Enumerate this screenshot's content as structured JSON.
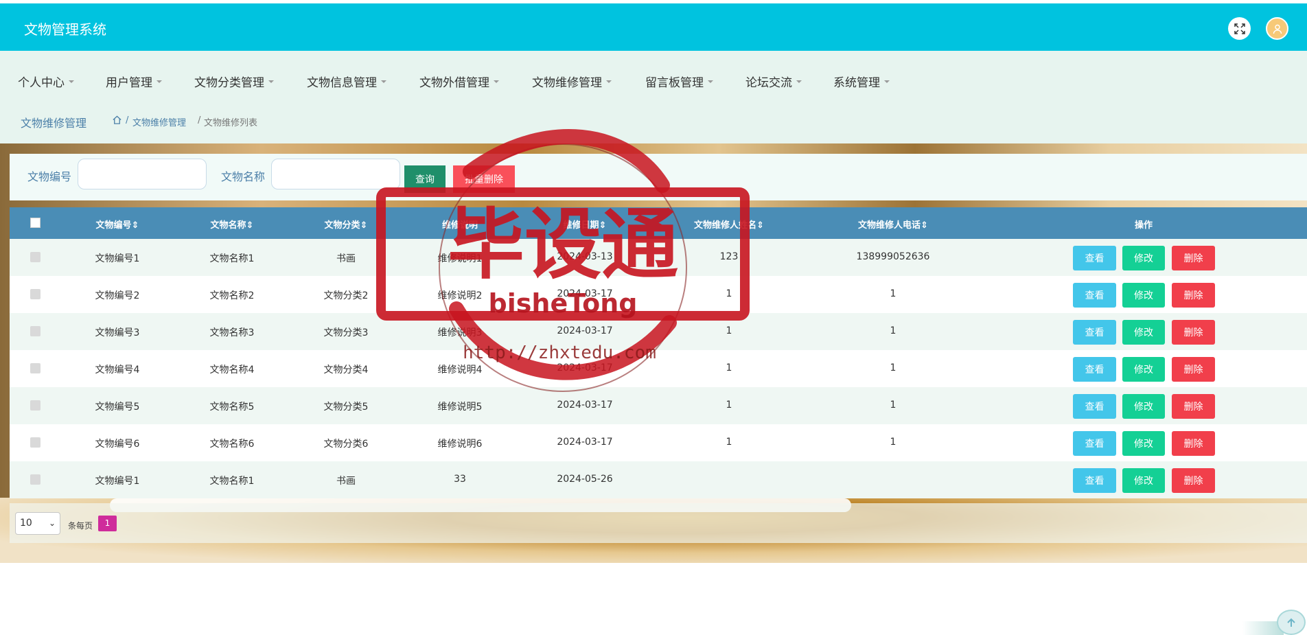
{
  "app": {
    "title": "文物管理系统"
  },
  "nav": [
    {
      "label": "个人中心"
    },
    {
      "label": "用户管理"
    },
    {
      "label": "文物分类管理"
    },
    {
      "label": "文物信息管理"
    },
    {
      "label": "文物外借管理"
    },
    {
      "label": "文物维修管理"
    },
    {
      "label": "留言板管理"
    },
    {
      "label": "论坛交流"
    },
    {
      "label": "系统管理"
    }
  ],
  "breadcrumb": {
    "title": "文物维修管理",
    "sep": "/",
    "link": "文物维修管理",
    "current": "文物维修列表"
  },
  "search": {
    "field1_label": "文物编号",
    "field1_value": "",
    "field2_label": "文物名称",
    "field2_value": "",
    "search_label": "查询",
    "bulk_delete_label": "批量删除"
  },
  "table": {
    "headers": [
      "文物编号",
      "文物名称",
      "文物分类",
      "维修说明",
      "维修日期",
      "文物维修人姓名",
      "文物维修人电话",
      "操作"
    ],
    "sort_glyph": "⇕",
    "rows": [
      [
        "文物编号1",
        "文物名称1",
        "书画",
        "维修说明1",
        "2024-03-13",
        "123",
        "138999052636"
      ],
      [
        "文物编号2",
        "文物名称2",
        "文物分类2",
        "维修说明2",
        "2024-03-17",
        "1",
        "1"
      ],
      [
        "文物编号3",
        "文物名称3",
        "文物分类3",
        "维修说明3",
        "2024-03-17",
        "1",
        "1"
      ],
      [
        "文物编号4",
        "文物名称4",
        "文物分类4",
        "维修说明4",
        "2024-03-17",
        "1",
        "1"
      ],
      [
        "文物编号5",
        "文物名称5",
        "文物分类5",
        "维修说明5",
        "2024-03-17",
        "1",
        "1"
      ],
      [
        "文物编号6",
        "文物名称6",
        "文物分类6",
        "维修说明6",
        "2024-03-17",
        "1",
        "1"
      ],
      [
        "文物编号1",
        "文物名称1",
        "书画",
        "33",
        "2024-05-26",
        "",
        ""
      ]
    ],
    "actions": {
      "view": "查看",
      "edit": "修改",
      "delete": "删除"
    }
  },
  "pager": {
    "page_size": "10",
    "per_page_label": "条每页",
    "current_page": "1"
  },
  "watermark": {
    "main": "毕设通",
    "sub": "bisheTong",
    "url": "http://zhxtedu.com"
  },
  "colors": {
    "topbar": "#00c3df",
    "table_header": "#4a8db6",
    "view": "#43c6ea",
    "edit": "#14d095",
    "delete": "#f13f4b",
    "stamp": "#c8141f"
  },
  "icons": {
    "fullscreen": "fullscreen-icon",
    "avatar": "user-icon",
    "home": "home-icon",
    "back_to_top": "arrow-up-icon"
  }
}
